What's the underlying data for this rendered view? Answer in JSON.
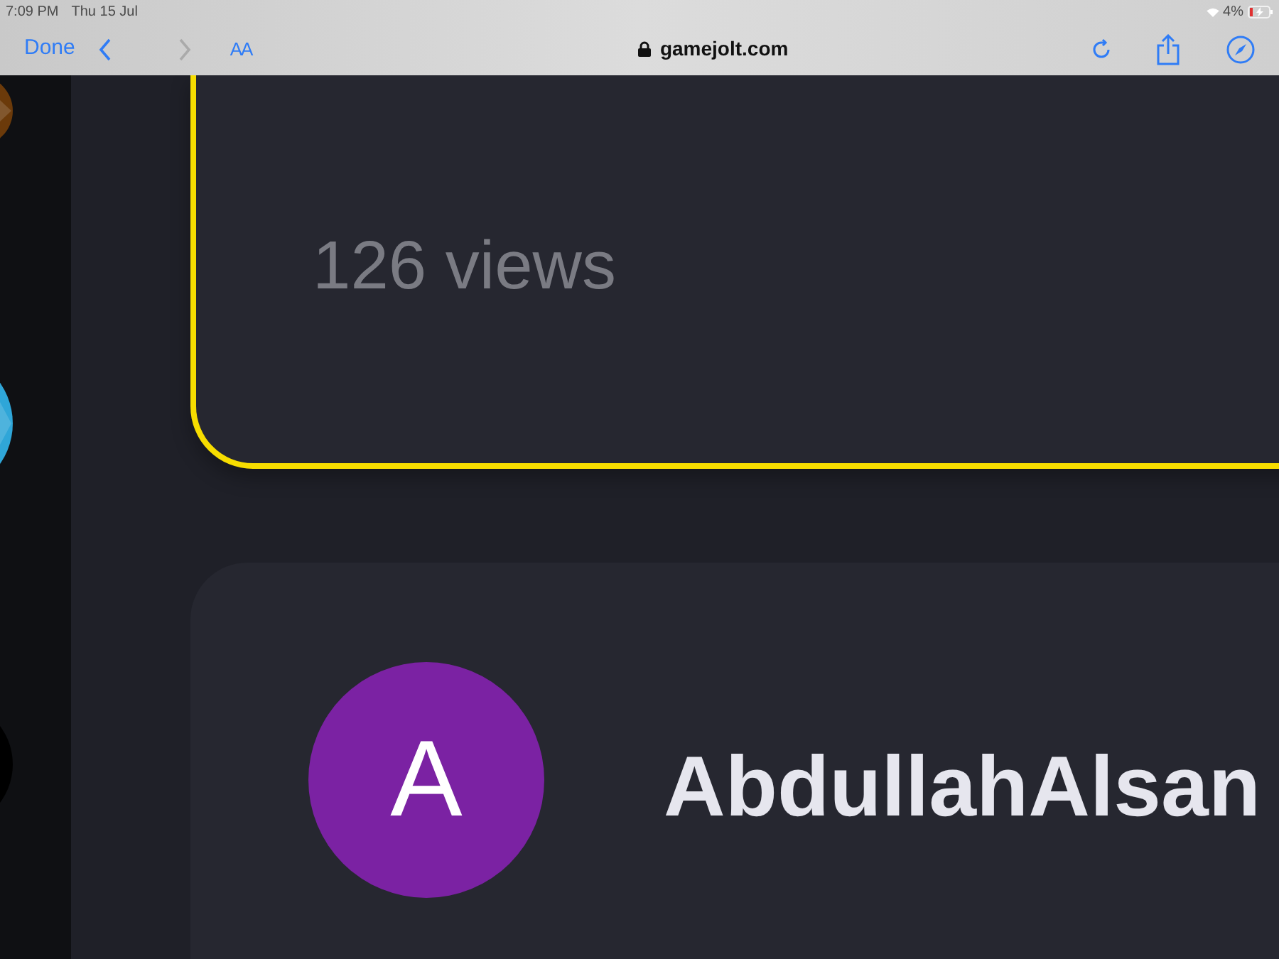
{
  "status_bar": {
    "time": "7:09 PM",
    "date": "Thu 15 Jul",
    "battery": "4%"
  },
  "browser_toolbar": {
    "done": "Done",
    "text_size": "AA",
    "address": "gamejolt.com"
  },
  "sidebar": {
    "items": [
      {
        "color": "#6b3a0a"
      },
      {
        "color": "#2fa6d8"
      },
      {
        "color": "#000000"
      }
    ]
  },
  "post_card": {
    "views": "126 views"
  },
  "user_card": {
    "avatar_letter": "A",
    "username": "AbdullahAlsan"
  }
}
